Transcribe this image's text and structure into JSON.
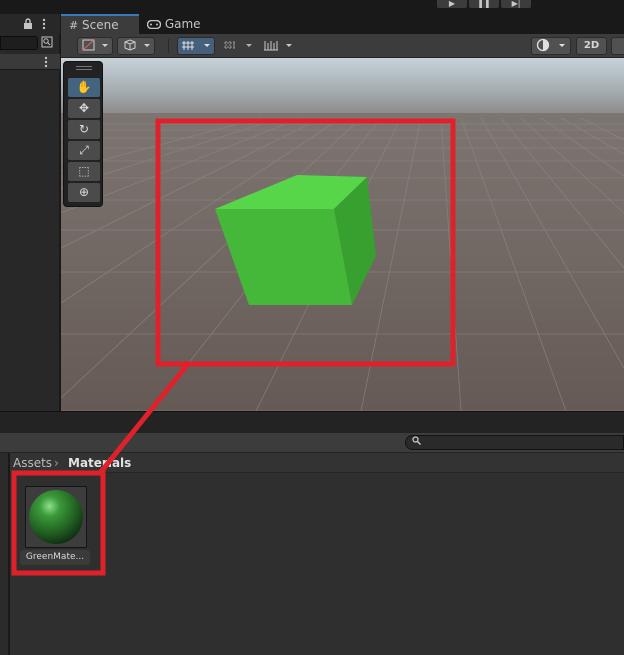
{
  "colors": {
    "accent": "#3a79bb",
    "annotation": "#e0212b",
    "cube_front": "#45b83a",
    "cube_top": "#57d64a",
    "cube_side": "#37a02e"
  },
  "icons": {
    "lock": "lock-icon",
    "menu": "kebab-menu-icon",
    "search": "search-icon",
    "play": "play-icon",
    "pause": "pause-icon",
    "step": "step-icon",
    "scene_tab": "hash-icon",
    "game_tab": "gamepad-icon"
  },
  "tabs": [
    {
      "label": "Scene",
      "active": true
    },
    {
      "label": "Game",
      "active": false
    }
  ],
  "playbar": {
    "play": "▶",
    "pause": "❚❚",
    "step": "▶|"
  },
  "scene_toolbar": {
    "mode_2d": "2D"
  },
  "tools": [
    {
      "name": "hand-tool",
      "glyph": "✋",
      "active": true
    },
    {
      "name": "move-tool",
      "glyph": "✥",
      "active": false
    },
    {
      "name": "rotate-tool",
      "glyph": "↻",
      "active": false
    },
    {
      "name": "scale-tool",
      "glyph": "⤢",
      "active": false
    },
    {
      "name": "rect-tool",
      "glyph": "⬚",
      "active": false
    },
    {
      "name": "transform-tool",
      "glyph": "⊕",
      "active": false
    }
  ],
  "project": {
    "breadcrumb": [
      "Assets",
      "Materials"
    ],
    "separator": "›",
    "assets": [
      {
        "label": "GreenMate...",
        "type": "material"
      }
    ]
  }
}
